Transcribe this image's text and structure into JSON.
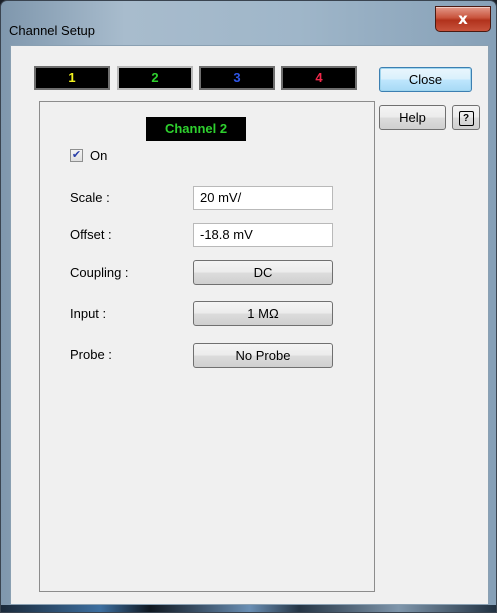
{
  "window": {
    "title": "Channel Setup",
    "close_glyph": "x"
  },
  "tabs": [
    {
      "label": "1",
      "color": "#f2f21e"
    },
    {
      "label": "2",
      "color": "#2ed02e"
    },
    {
      "label": "3",
      "color": "#2f56e8"
    },
    {
      "label": "4",
      "color": "#f0284a"
    }
  ],
  "active_tab": "2",
  "panel": {
    "channel_title": "Channel 2",
    "on_label": "On",
    "on_checked": true,
    "scale_label": "Scale :",
    "scale_value": "20 mV/",
    "offset_label": "Offset :",
    "offset_value": "-18.8 mV",
    "coupling_label": "Coupling :",
    "coupling_value": "DC",
    "input_label": "Input :",
    "input_value": "1 MΩ",
    "probe_label": "Probe :",
    "probe_value": "No Probe"
  },
  "side": {
    "close_label": "Close",
    "help_label": "Help",
    "help_icon_glyph": "?"
  }
}
